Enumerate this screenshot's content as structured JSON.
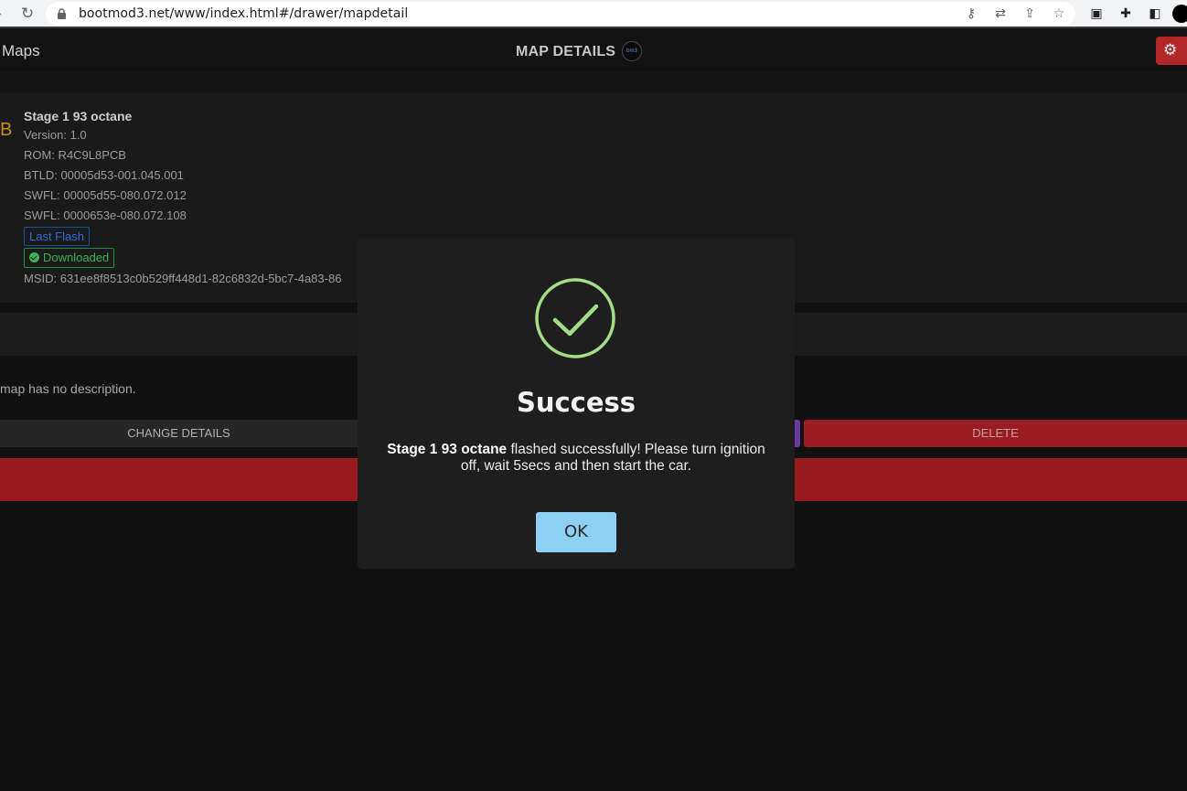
{
  "browser": {
    "url": "bootmod3.net/www/index.html#/drawer/mapdetail",
    "forward_glyph": "›",
    "reload_glyph": "↻",
    "key_glyph": "⚷",
    "translate_glyph": "⇄",
    "share_glyph": "⇪",
    "star_glyph": "☆",
    "screen_glyph": "▣",
    "extensions_glyph": "✚",
    "sidepanel_glyph": "◧"
  },
  "header": {
    "back_label": "Maps",
    "title": "MAP DETAILS",
    "settings_glyph": "⚙"
  },
  "map": {
    "logo_glyph": "B",
    "name": "Stage 1 93 octane",
    "version": "Version: 1.0",
    "rom": "ROM: R4C9L8PCB",
    "btld": "BTLD: 00005d53-001.045.001",
    "swfl1": "SWFL: 00005d55-080.072.012",
    "swfl2": "SWFL: 0000653e-080.072.108",
    "badge_last_flash": "Last Flash",
    "badge_downloaded": "Downloaded",
    "msid": "MSID: 631ee8f8513c0b529ff448d1-82c6832d-5bc7-4a83-86"
  },
  "description": "map has no description.",
  "actions": {
    "change_details": "CHANGE DETAILS",
    "delete": "DELETE"
  },
  "modal": {
    "title": "Success",
    "message_bold": "Stage 1 93 octane",
    "message_rest": " flashed successfully! Please turn ignition off, wait 5secs and then start the car.",
    "ok_label": "OK"
  },
  "colors": {
    "accent_red": "#9b1c22",
    "success_green": "#a5dc86",
    "ok_blue": "#8dd0f3"
  }
}
